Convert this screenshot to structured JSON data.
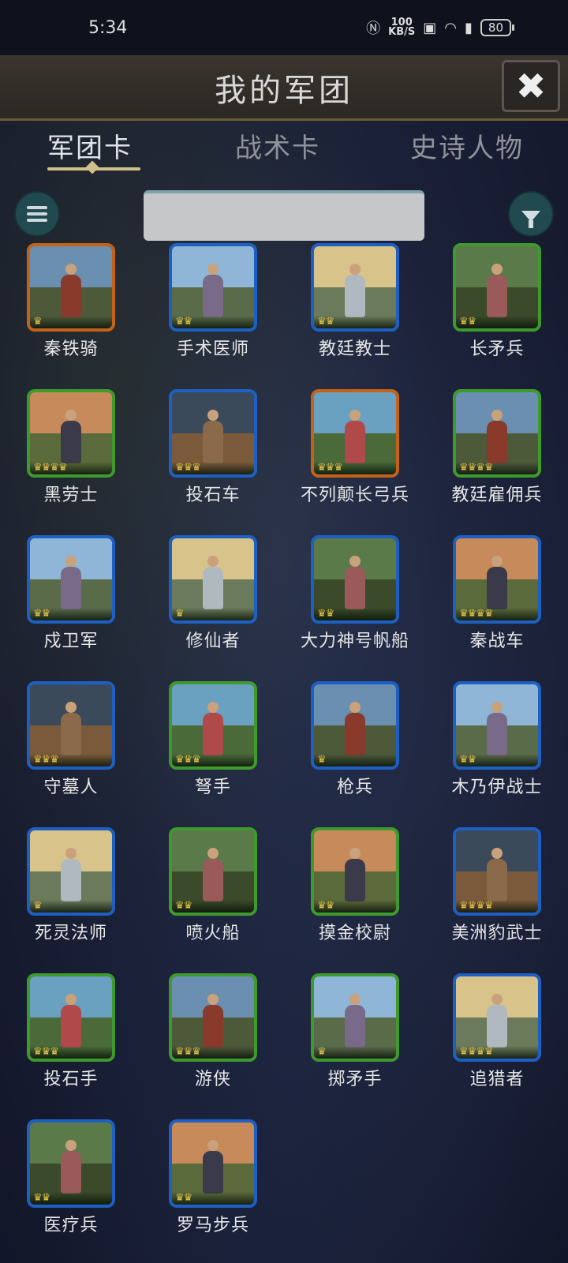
{
  "status_bar": {
    "time": "5:34",
    "net_speed_value": "100",
    "net_speed_unit": "KB/S",
    "battery": "80"
  },
  "header": {
    "title": "我的军团"
  },
  "tabs": [
    {
      "label": "军团卡",
      "active": true
    },
    {
      "label": "战术卡",
      "active": false
    },
    {
      "label": "史诗人物",
      "active": false
    }
  ],
  "units": [
    {
      "name": "秦铁骑",
      "rarity": "orange",
      "crowns": 1
    },
    {
      "name": "手术医师",
      "rarity": "blue",
      "crowns": 2
    },
    {
      "name": "教廷教士",
      "rarity": "blue",
      "crowns": 2
    },
    {
      "name": "长矛兵",
      "rarity": "green",
      "crowns": 2
    },
    {
      "name": "黑劳士",
      "rarity": "green",
      "crowns": 4
    },
    {
      "name": "投石车",
      "rarity": "blue",
      "crowns": 3
    },
    {
      "name": "不列颠长弓兵",
      "rarity": "orange",
      "crowns": 3
    },
    {
      "name": "教廷雇佣兵",
      "rarity": "green",
      "crowns": 4
    },
    {
      "name": "戍卫军",
      "rarity": "blue",
      "crowns": 2
    },
    {
      "name": "修仙者",
      "rarity": "blue",
      "crowns": 1
    },
    {
      "name": "大力神号帆船",
      "rarity": "blue",
      "crowns": 2
    },
    {
      "name": "秦战车",
      "rarity": "blue",
      "crowns": 4
    },
    {
      "name": "守墓人",
      "rarity": "blue",
      "crowns": 3
    },
    {
      "name": "弩手",
      "rarity": "green",
      "crowns": 3
    },
    {
      "name": "枪兵",
      "rarity": "blue",
      "crowns": 1
    },
    {
      "name": "木乃伊战士",
      "rarity": "blue",
      "crowns": 2
    },
    {
      "name": "死灵法师",
      "rarity": "blue",
      "crowns": 1
    },
    {
      "name": "喷火船",
      "rarity": "green",
      "crowns": 2
    },
    {
      "name": "摸金校尉",
      "rarity": "green",
      "crowns": 2
    },
    {
      "name": "美洲豹武士",
      "rarity": "blue",
      "crowns": 4
    },
    {
      "name": "投石手",
      "rarity": "green",
      "crowns": 3
    },
    {
      "name": "游侠",
      "rarity": "green",
      "crowns": 3
    },
    {
      "name": "掷矛手",
      "rarity": "green",
      "crowns": 1
    },
    {
      "name": "追猎者",
      "rarity": "blue",
      "crowns": 4
    },
    {
      "name": "医疗兵",
      "rarity": "blue",
      "crowns": 2
    },
    {
      "name": "罗马步兵",
      "rarity": "blue",
      "crowns": 2
    }
  ],
  "colors": {
    "rarity_blue": "#1e5fc2",
    "rarity_green": "#3f9a2e",
    "rarity_orange": "#c4621a",
    "crown": "#e3c24a"
  }
}
